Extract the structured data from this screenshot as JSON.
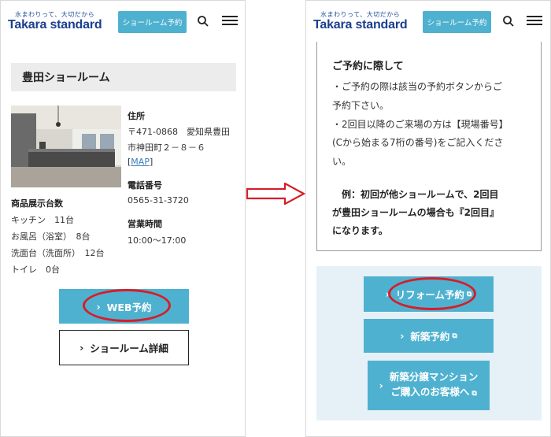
{
  "header": {
    "tagline": "水まわりって、大切だから",
    "logo": "Takara standard",
    "reserve_label": "ショールーム予約"
  },
  "left": {
    "title": "豊田ショールーム",
    "address_label": "住所",
    "address_lines": [
      "〒471-0868　愛知県豊田",
      "市神田町２－８－６"
    ],
    "map_link": "MAP",
    "phone_label": "電話番号",
    "phone": "0565-31-3720",
    "hours_label": "営業時間",
    "hours": "10:00〜17:00",
    "display_label": "商品展示台数",
    "display_items": [
      "キッチン　11台",
      "お風呂（浴室）　8台",
      "洗面台（洗面所）　12台",
      "トイレ　0台"
    ],
    "web_button": "WEB予約",
    "detail_button": "ショールーム詳細"
  },
  "right": {
    "note_title": "ご予約に際して",
    "note_lines": [
      "・ご予約の際は該当の予約ボタンからご",
      "予約下さい。",
      "・2回目以降のご来場の方は【現場番号】",
      "(Cから始まる7桁の番号)をご記入くださ",
      "い。"
    ],
    "example_lines": [
      "　例：初回が他ショールームで、2回目",
      "が豊田ショールームの場合も『2回目』",
      "になります。"
    ],
    "reform_button": "リフォーム予約",
    "new_button": "新築予約",
    "condo_button_lines": [
      "新築分譲マンション",
      "ご購入のお客様へ"
    ]
  },
  "colors": {
    "accent": "#4fb1d0",
    "logo": "#1a3f8f",
    "highlight": "#d61e28",
    "arrow": "#d61e28"
  }
}
